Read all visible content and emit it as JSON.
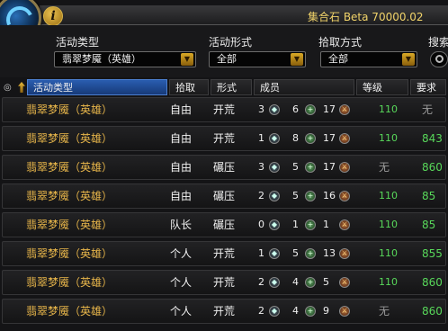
{
  "app": {
    "title": "集合石 Beta 70000.02",
    "info_glyph": "i"
  },
  "filters": {
    "type_label": "活动类型",
    "type_value": "翡翠梦魇（英雄）",
    "form_label": "活动形式",
    "form_value": "全部",
    "loot_label": "拾取方式",
    "loot_value": "全部",
    "search_label": "搜索"
  },
  "headers": {
    "type": "活动类型",
    "loot": "拾取",
    "form": "形式",
    "members": "成员",
    "level": "等级",
    "req": "要求"
  },
  "colors": {
    "gold": "#e8b64a",
    "green": "#58d85a",
    "grey": "#9a9a9a",
    "active_header": "#2a5db0"
  },
  "rows": [
    {
      "name": "翡翠梦魇（英雄）",
      "loot": "自由",
      "form": "开荒",
      "tank": "3",
      "heal": "6",
      "dps": "17",
      "level": "110",
      "req": "无"
    },
    {
      "name": "翡翠梦魇（英雄）",
      "loot": "自由",
      "form": "开荒",
      "tank": "1",
      "heal": "8",
      "dps": "17",
      "level": "110",
      "req": "843"
    },
    {
      "name": "翡翠梦魇（英雄）",
      "loot": "自由",
      "form": "碾压",
      "tank": "3",
      "heal": "5",
      "dps": "17",
      "level": "无",
      "req": "860"
    },
    {
      "name": "翡翠梦魇（英雄）",
      "loot": "自由",
      "form": "碾压",
      "tank": "2",
      "heal": "5",
      "dps": "16",
      "level": "110",
      "req": "85"
    },
    {
      "name": "翡翠梦魇（英雄）",
      "loot": "队长",
      "form": "碾压",
      "tank": "0",
      "heal": "1",
      "dps": "1",
      "level": "110",
      "req": "85"
    },
    {
      "name": "翡翠梦魇（英雄）",
      "loot": "个人",
      "form": "开荒",
      "tank": "1",
      "heal": "5",
      "dps": "13",
      "level": "110",
      "req": "855"
    },
    {
      "name": "翡翠梦魇（英雄）",
      "loot": "个人",
      "form": "开荒",
      "tank": "2",
      "heal": "4",
      "dps": "5",
      "level": "110",
      "req": "860"
    },
    {
      "name": "翡翠梦魇（英雄）",
      "loot": "个人",
      "form": "开荒",
      "tank": "2",
      "heal": "4",
      "dps": "9",
      "level": "无",
      "req": "860"
    }
  ]
}
